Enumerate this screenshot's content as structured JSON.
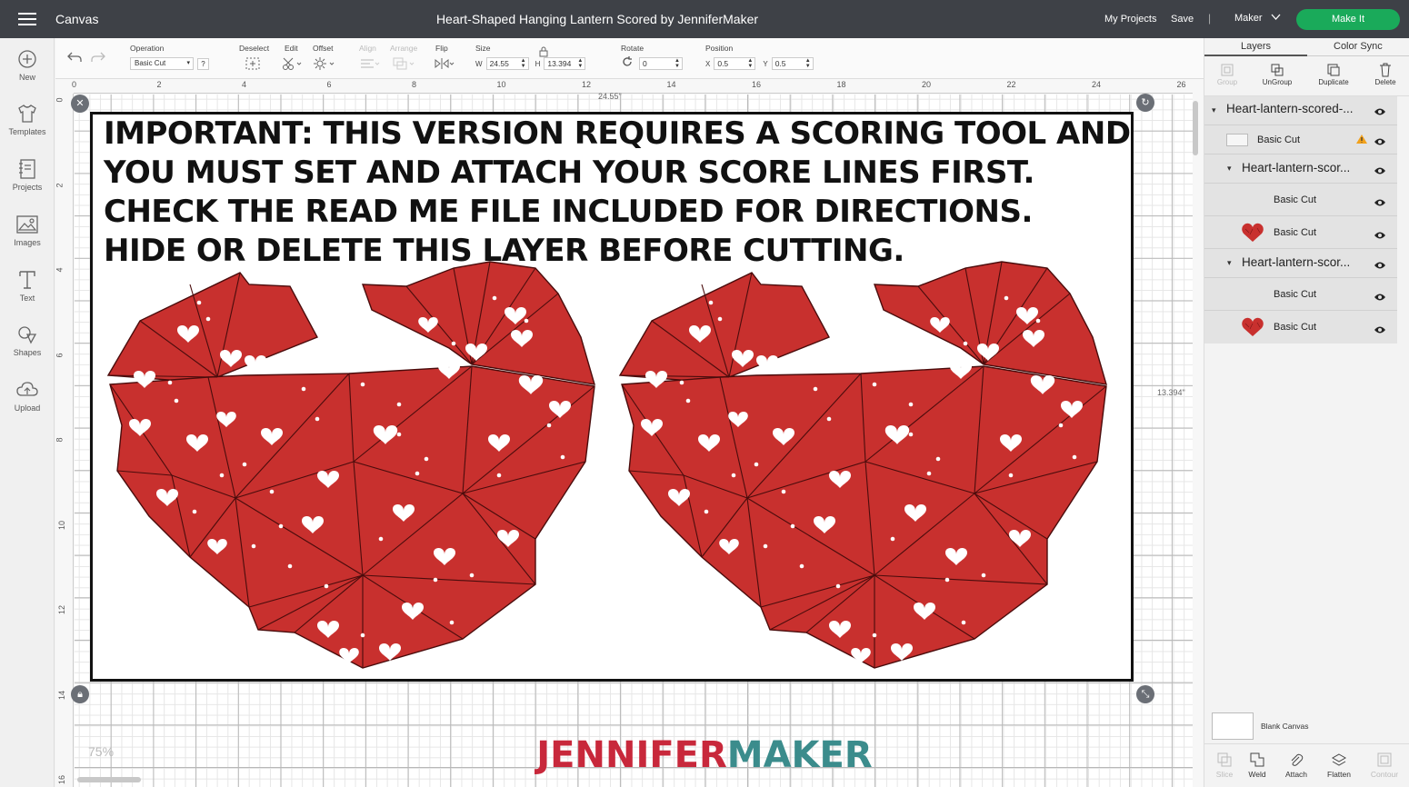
{
  "topbar": {
    "app_title": "Canvas",
    "doc_title": "Heart-Shaped Hanging Lantern Scored by JenniferMaker",
    "my_projects": "My Projects",
    "save": "Save",
    "separator": "|",
    "machine": "Maker",
    "make_it": "Make It"
  },
  "leftbar": {
    "tools": [
      {
        "label": "New",
        "icon": "plus-circle-icon"
      },
      {
        "label": "Templates",
        "icon": "tshirt-icon"
      },
      {
        "label": "Projects",
        "icon": "projects-icon"
      },
      {
        "label": "Images",
        "icon": "images-icon"
      },
      {
        "label": "Text",
        "icon": "text-icon"
      },
      {
        "label": "Shapes",
        "icon": "shapes-icon"
      },
      {
        "label": "Upload",
        "icon": "upload-icon"
      }
    ]
  },
  "toolbar": {
    "operation_label": "Operation",
    "operation_value": "Basic Cut",
    "help": "?",
    "deselect_label": "Deselect",
    "edit_label": "Edit",
    "offset_label": "Offset",
    "align_label": "Align",
    "arrange_label": "Arrange",
    "flip_label": "Flip",
    "size_label": "Size",
    "w_label": "W",
    "w_value": "24.55",
    "h_label": "H",
    "h_value": "13.394",
    "rotate_label": "Rotate",
    "rotate_value": "0",
    "position_label": "Position",
    "x_label": "X",
    "x_value": "0.5",
    "y_label": "Y",
    "y_value": "0.5"
  },
  "canvas": {
    "ruler_top": [
      "0",
      "2",
      "4",
      "6",
      "8",
      "10",
      "12",
      "14",
      "16",
      "18",
      "20",
      "22",
      "24",
      "26"
    ],
    "ruler_left": [
      "0",
      "2",
      "4",
      "6",
      "8",
      "10",
      "12",
      "14",
      "16"
    ],
    "width_dim": "24.55\"",
    "height_dim": "13.394\"",
    "notice_lines": [
      "IMPORTANT: THIS VERSION REQUIRES A SCORING TOOL AND",
      "YOU MUST SET AND ATTACH YOUR SCORE LINES FIRST.",
      "CHECK THE READ ME FILE INCLUDED FOR DIRECTIONS.",
      "HIDE OR DELETE THIS LAYER BEFORE CUTTING."
    ],
    "zoom": "75%",
    "heart_color": "#c8302e"
  },
  "brand": {
    "part1": "JENNIFER",
    "part2": "MAKER",
    "color1": "#c8283b",
    "color2": "#3b8c8c"
  },
  "rightpanel": {
    "tabs": [
      "Layers",
      "Color Sync"
    ],
    "tools": [
      {
        "label": "Group",
        "enabled": false
      },
      {
        "label": "UnGroup",
        "enabled": true
      },
      {
        "label": "Duplicate",
        "enabled": true
      },
      {
        "label": "Delete",
        "enabled": true
      }
    ],
    "layers": [
      {
        "name": "Heart-lantern-scored-..."
      },
      {
        "sub": "Basic Cut",
        "thumb": "rect",
        "warning": true
      },
      {
        "name": "Heart-lantern-scor..."
      },
      {
        "sub": "Basic Cut",
        "thumb": "empty"
      },
      {
        "sub": "Basic Cut",
        "thumb": "heart"
      },
      {
        "name": "Heart-lantern-scor..."
      },
      {
        "sub": "Basic Cut",
        "thumb": "empty"
      },
      {
        "sub": "Basic Cut",
        "thumb": "heart"
      }
    ],
    "blank_canvas": "Blank Canvas",
    "bottom_tools": [
      {
        "label": "Slice",
        "enabled": false
      },
      {
        "label": "Weld",
        "enabled": true
      },
      {
        "label": "Attach",
        "enabled": true
      },
      {
        "label": "Flatten",
        "enabled": true
      },
      {
        "label": "Contour",
        "enabled": false
      }
    ]
  }
}
